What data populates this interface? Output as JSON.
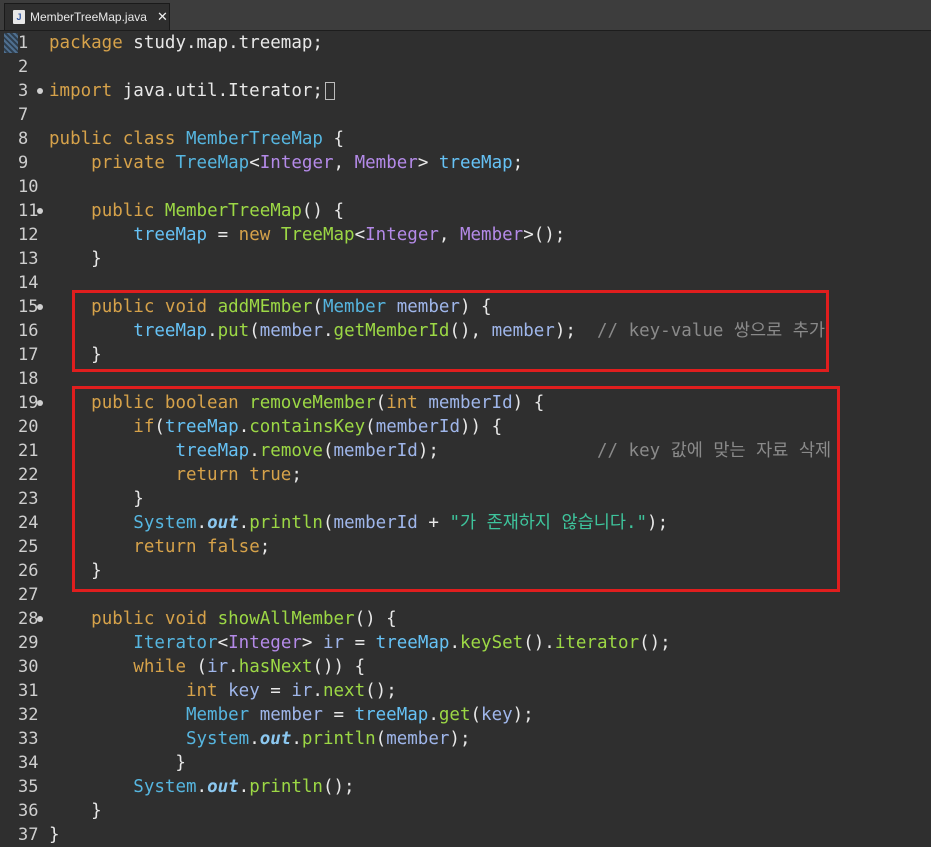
{
  "tab": {
    "file_icon_letter": "J",
    "title": "MemberTreeMap.java",
    "close": "✕"
  },
  "lines": [
    {
      "n": "1",
      "tokens": [
        [
          "kw",
          "package"
        ],
        [
          "pl",
          " study.map.treemap;"
        ]
      ]
    },
    {
      "n": "2",
      "tokens": []
    },
    {
      "n": "3",
      "fold": true,
      "tokens": [
        [
          "kw",
          "import"
        ],
        [
          "pl",
          " java.util.Iterator;"
        ]
      ],
      "collapsed": true
    },
    {
      "n": "7",
      "tokens": []
    },
    {
      "n": "8",
      "tokens": [
        [
          "kw",
          "public class "
        ],
        [
          "ty",
          "MemberTreeMap"
        ],
        [
          "pl",
          " {"
        ]
      ]
    },
    {
      "n": "9",
      "tokens": [
        [
          "pl",
          "    "
        ],
        [
          "kw",
          "private "
        ],
        [
          "ty",
          "TreeMap"
        ],
        [
          "pl",
          "<"
        ],
        [
          "gn",
          "Integer"
        ],
        [
          "pl",
          ", "
        ],
        [
          "gn",
          "Member"
        ],
        [
          "pl",
          "> "
        ],
        [
          "fd",
          "treeMap"
        ],
        [
          "pl",
          ";"
        ]
      ]
    },
    {
      "n": "10",
      "tokens": []
    },
    {
      "n": "11",
      "fold": true,
      "tokens": [
        [
          "pl",
          "    "
        ],
        [
          "kw",
          "public "
        ],
        [
          "fn",
          "MemberTreeMap"
        ],
        [
          "pl",
          "() {"
        ]
      ]
    },
    {
      "n": "12",
      "tokens": [
        [
          "pl",
          "        "
        ],
        [
          "fd",
          "treeMap"
        ],
        [
          "pl",
          " = "
        ],
        [
          "kw",
          "new "
        ],
        [
          "fn",
          "TreeMap"
        ],
        [
          "pl",
          "<"
        ],
        [
          "gn",
          "Integer"
        ],
        [
          "pl",
          ", "
        ],
        [
          "gn",
          "Member"
        ],
        [
          "pl",
          ">();"
        ]
      ]
    },
    {
      "n": "13",
      "tokens": [
        [
          "pl",
          "    }"
        ]
      ]
    },
    {
      "n": "14",
      "tokens": []
    },
    {
      "n": "15",
      "fold": true,
      "tokens": [
        [
          "pl",
          "    "
        ],
        [
          "kw",
          "public void "
        ],
        [
          "fn",
          "addMEmber"
        ],
        [
          "pl",
          "("
        ],
        [
          "ty",
          "Member"
        ],
        [
          "pa",
          " member"
        ],
        [
          "pl",
          ") {"
        ]
      ]
    },
    {
      "n": "16",
      "tokens": [
        [
          "pl",
          "        "
        ],
        [
          "fd",
          "treeMap"
        ],
        [
          "pl",
          "."
        ],
        [
          "fn",
          "put"
        ],
        [
          "pl",
          "("
        ],
        [
          "pa",
          "member"
        ],
        [
          "pl",
          "."
        ],
        [
          "fn",
          "getMemberId"
        ],
        [
          "pl",
          "(), "
        ],
        [
          "pa",
          "member"
        ],
        [
          "pl",
          ");  "
        ],
        [
          "cm",
          "// key-value 쌍으로 추가"
        ]
      ]
    },
    {
      "n": "17",
      "tokens": [
        [
          "pl",
          "    }"
        ]
      ]
    },
    {
      "n": "18",
      "tokens": []
    },
    {
      "n": "19",
      "fold": true,
      "tokens": [
        [
          "pl",
          "    "
        ],
        [
          "kw",
          "public boolean "
        ],
        [
          "fn",
          "removeMember"
        ],
        [
          "pl",
          "("
        ],
        [
          "kw",
          "int"
        ],
        [
          "pa",
          " memberId"
        ],
        [
          "pl",
          ") {"
        ]
      ]
    },
    {
      "n": "20",
      "tokens": [
        [
          "pl",
          "        "
        ],
        [
          "kw",
          "if"
        ],
        [
          "pl",
          "("
        ],
        [
          "fd",
          "treeMap"
        ],
        [
          "pl",
          "."
        ],
        [
          "fn",
          "containsKey"
        ],
        [
          "pl",
          "("
        ],
        [
          "pa",
          "memberId"
        ],
        [
          "pl",
          ")) {"
        ]
      ]
    },
    {
      "n": "21",
      "tokens": [
        [
          "pl",
          "            "
        ],
        [
          "fd",
          "treeMap"
        ],
        [
          "pl",
          "."
        ],
        [
          "fn",
          "remove"
        ],
        [
          "pl",
          "("
        ],
        [
          "pa",
          "memberId"
        ],
        [
          "pl",
          ");               "
        ],
        [
          "cm",
          "// key 값에 맞는 자료 삭제"
        ]
      ]
    },
    {
      "n": "22",
      "tokens": [
        [
          "pl",
          "            "
        ],
        [
          "kw",
          "return true"
        ],
        [
          "pl",
          ";"
        ]
      ]
    },
    {
      "n": "23",
      "tokens": [
        [
          "pl",
          "        }"
        ]
      ]
    },
    {
      "n": "24",
      "tokens": [
        [
          "pl",
          "        "
        ],
        [
          "ty",
          "System"
        ],
        [
          "pl",
          "."
        ],
        [
          "it",
          "out"
        ],
        [
          "pl",
          "."
        ],
        [
          "fn",
          "println"
        ],
        [
          "pl",
          "("
        ],
        [
          "pa",
          "memberId"
        ],
        [
          "pl",
          " + "
        ],
        [
          "st",
          "\"가 존재하지 않습니다.\""
        ],
        [
          "pl",
          ");"
        ]
      ]
    },
    {
      "n": "25",
      "tokens": [
        [
          "pl",
          "        "
        ],
        [
          "kw",
          "return false"
        ],
        [
          "pl",
          ";"
        ]
      ]
    },
    {
      "n": "26",
      "tokens": [
        [
          "pl",
          "    }"
        ]
      ]
    },
    {
      "n": "27",
      "tokens": []
    },
    {
      "n": "28",
      "fold": true,
      "tokens": [
        [
          "pl",
          "    "
        ],
        [
          "kw",
          "public void "
        ],
        [
          "fn",
          "showAllMember"
        ],
        [
          "pl",
          "() {"
        ]
      ]
    },
    {
      "n": "29",
      "tokens": [
        [
          "pl",
          "        "
        ],
        [
          "ty",
          "Iterator"
        ],
        [
          "pl",
          "<"
        ],
        [
          "gn",
          "Integer"
        ],
        [
          "pl",
          "> "
        ],
        [
          "pa",
          "ir"
        ],
        [
          "pl",
          " = "
        ],
        [
          "fd",
          "treeMap"
        ],
        [
          "pl",
          "."
        ],
        [
          "fn",
          "keySet"
        ],
        [
          "pl",
          "()."
        ],
        [
          "fn",
          "iterator"
        ],
        [
          "pl",
          "();"
        ]
      ]
    },
    {
      "n": "30",
      "tokens": [
        [
          "pl",
          "        "
        ],
        [
          "kw",
          "while"
        ],
        [
          "pl",
          " ("
        ],
        [
          "pa",
          "ir"
        ],
        [
          "pl",
          "."
        ],
        [
          "fn",
          "hasNext"
        ],
        [
          "pl",
          "()) {"
        ]
      ]
    },
    {
      "n": "31",
      "tokens": [
        [
          "pl",
          "             "
        ],
        [
          "kw",
          "int "
        ],
        [
          "pa",
          "key"
        ],
        [
          "pl",
          " = "
        ],
        [
          "pa",
          "ir"
        ],
        [
          "pl",
          "."
        ],
        [
          "fn",
          "next"
        ],
        [
          "pl",
          "();"
        ]
      ]
    },
    {
      "n": "32",
      "tokens": [
        [
          "pl",
          "             "
        ],
        [
          "ty",
          "Member "
        ],
        [
          "pa",
          "member"
        ],
        [
          "pl",
          " = "
        ],
        [
          "fd",
          "treeMap"
        ],
        [
          "pl",
          "."
        ],
        [
          "fn",
          "get"
        ],
        [
          "pl",
          "("
        ],
        [
          "pa",
          "key"
        ],
        [
          "pl",
          ");"
        ]
      ]
    },
    {
      "n": "33",
      "tokens": [
        [
          "pl",
          "             "
        ],
        [
          "ty",
          "System"
        ],
        [
          "pl",
          "."
        ],
        [
          "it",
          "out"
        ],
        [
          "pl",
          "."
        ],
        [
          "fn",
          "println"
        ],
        [
          "pl",
          "("
        ],
        [
          "pa",
          "member"
        ],
        [
          "pl",
          ");"
        ]
      ]
    },
    {
      "n": "34",
      "tokens": [
        [
          "pl",
          "            }"
        ]
      ]
    },
    {
      "n": "35",
      "tokens": [
        [
          "pl",
          "        "
        ],
        [
          "ty",
          "System"
        ],
        [
          "pl",
          "."
        ],
        [
          "it",
          "out"
        ],
        [
          "pl",
          "."
        ],
        [
          "fn",
          "println"
        ],
        [
          "pl",
          "();"
        ]
      ]
    },
    {
      "n": "36",
      "tokens": [
        [
          "pl",
          "    }"
        ]
      ]
    },
    {
      "n": "37",
      "tokens": [
        [
          "pl",
          "}"
        ]
      ]
    }
  ],
  "colors": {
    "highlight_box": "#e01e1e",
    "background": "#2f2f2f"
  }
}
